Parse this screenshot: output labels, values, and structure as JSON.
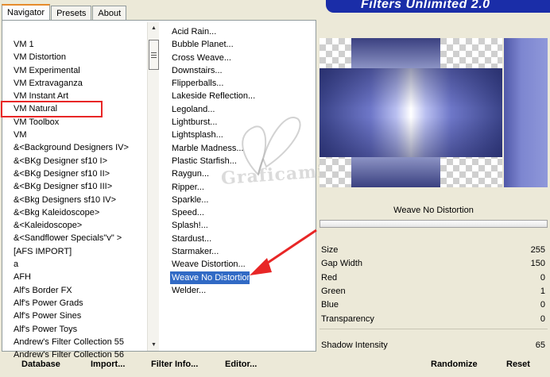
{
  "tabs": [
    "Navigator",
    "Presets",
    "About"
  ],
  "banner_title": "Filters Unlimited 2.0",
  "categories": [
    "VM 1",
    "VM Distortion",
    "VM Experimental",
    "VM Extravaganza",
    "VM Instant Art",
    "VM Natural",
    "VM Toolbox",
    "VM",
    "&<Background Designers IV>",
    "&<BKg Designer sf10 I>",
    "&<BKg Designer sf10 II>",
    "&<BKg Designer sf10 III>",
    "&<Bkg Designers sf10 IV>",
    "&<Bkg Kaleidoscope>",
    "&<Kaleidoscope>",
    "&<Sandflower Specials\"v\" >",
    "[AFS IMPORT]",
    "a",
    "AFH",
    "Alf's Border FX",
    "Alf's Power Grads",
    "Alf's Power Sines",
    "Alf's Power Toys",
    "Andrew's Filter Collection 55",
    "Andrew's Filter Collection 56"
  ],
  "category_selected_index": 5,
  "filters": [
    "Acid Rain...",
    "Bubble Planet...",
    "Cross Weave...",
    "Downstairs...",
    "Flipperballs...",
    "Lakeside Reflection...",
    "Legoland...",
    "Lightburst...",
    "Lightsplash...",
    "Marble Madness...",
    "Plastic Starfish...",
    "Raygun...",
    "Ripper...",
    "Sparkle...",
    "Speed...",
    "Splash!...",
    "Stardust...",
    "Starmaker...",
    "Weave Distortion...",
    "Weave No Distortion",
    "Welder..."
  ],
  "filter_selected_index": 19,
  "watermark_text": "Graficamia",
  "selected_filter_name": "Weave No Distortion",
  "params": [
    {
      "label": "Size",
      "value": "255"
    },
    {
      "label": "Gap Width",
      "value": "150"
    },
    {
      "label": "Red",
      "value": "0"
    },
    {
      "label": "Green",
      "value": "1"
    },
    {
      "label": "Blue",
      "value": "0"
    },
    {
      "label": "Transparency",
      "value": "0"
    },
    {
      "label": "",
      "value": ""
    },
    {
      "label": "Shadow Intensity",
      "value": "65"
    }
  ],
  "buttons": {
    "database": "Database",
    "import": "Import...",
    "filter_info": "Filter Info...",
    "editor": "Editor...",
    "randomize": "Randomize",
    "reset": "Reset"
  },
  "colors": {
    "selection": "#316ac5",
    "highlight_box": "#e82626",
    "banner": "#1a2da8",
    "arrow": "#e82626"
  }
}
